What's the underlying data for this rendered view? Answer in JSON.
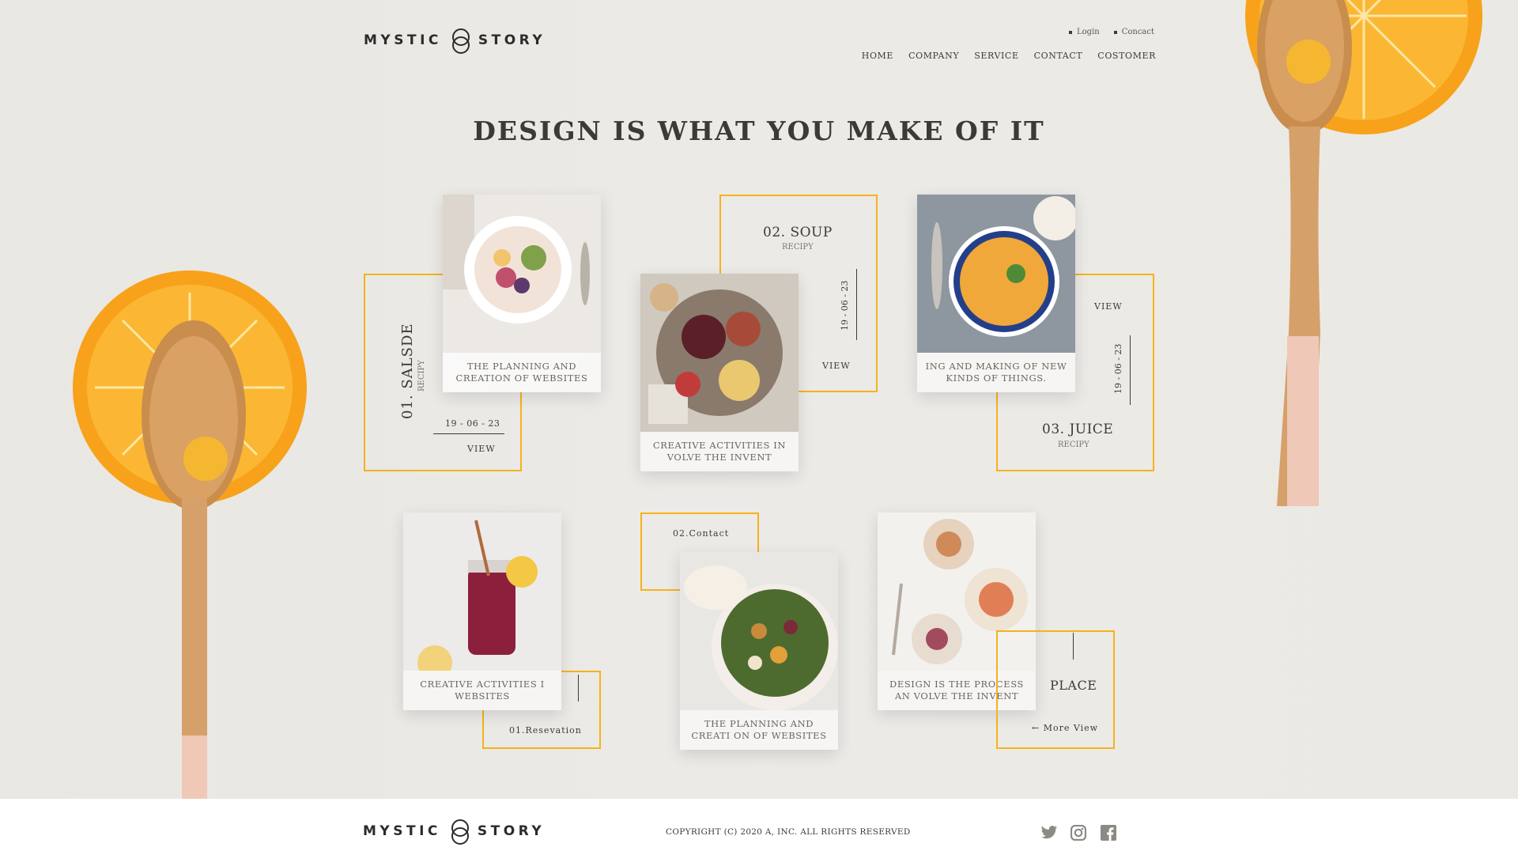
{
  "brand": {
    "name_left": "MYSTIC",
    "name_right": "STORY"
  },
  "top_links": [
    {
      "label": "Login"
    },
    {
      "label": "Concact"
    }
  ],
  "nav": [
    {
      "label": "HOME"
    },
    {
      "label": "COMPANY"
    },
    {
      "label": "SERVICE"
    },
    {
      "label": "CONTACT"
    },
    {
      "label": "COSTOMER"
    }
  ],
  "hero_title": "DESIGN IS WHAT YOU MAKE OF IT",
  "recipes": [
    {
      "title": "01. SALSDE",
      "sub": "RECIPY",
      "date": "19 - 06 - 23",
      "view": "VIEW",
      "caption": "THE PLANNING AND CREATION OF WEBSITES"
    },
    {
      "title": "02. SOUP",
      "sub": "RECIPY",
      "date": "19 - 06 - 23",
      "view": "VIEW",
      "caption": "CREATIVE ACTIVITIES IN VOLVE THE INVENT"
    },
    {
      "title": "03. JUICE",
      "sub": "RECIPY",
      "date": "19 - 06 - 23",
      "view": "VIEW",
      "caption": "ING AND MAKING OF NEW KINDS OF THINGS."
    }
  ],
  "lower": [
    {
      "label": "01.Resevation",
      "caption": "CREATIVE ACTIVITIES I WEBSITES"
    },
    {
      "label": "02.Contact",
      "caption": "THE PLANNING AND CREATI ON OF WEBSITES"
    },
    {
      "label": "PLACE",
      "link": "← More View",
      "caption": "DESIGN IS THE PROCESS AN VOLVE THE INVENT"
    }
  ],
  "footer": {
    "copyright": "COPYRIGHT (C) 2020 A, INC. ALL RIGHTS RESERVED"
  },
  "social_icons": [
    "twitter-icon",
    "instagram-icon",
    "facebook-icon"
  ],
  "colors": {
    "accent": "#f5b21e",
    "background": "#ebe9e4",
    "text": "#3d3a37"
  }
}
